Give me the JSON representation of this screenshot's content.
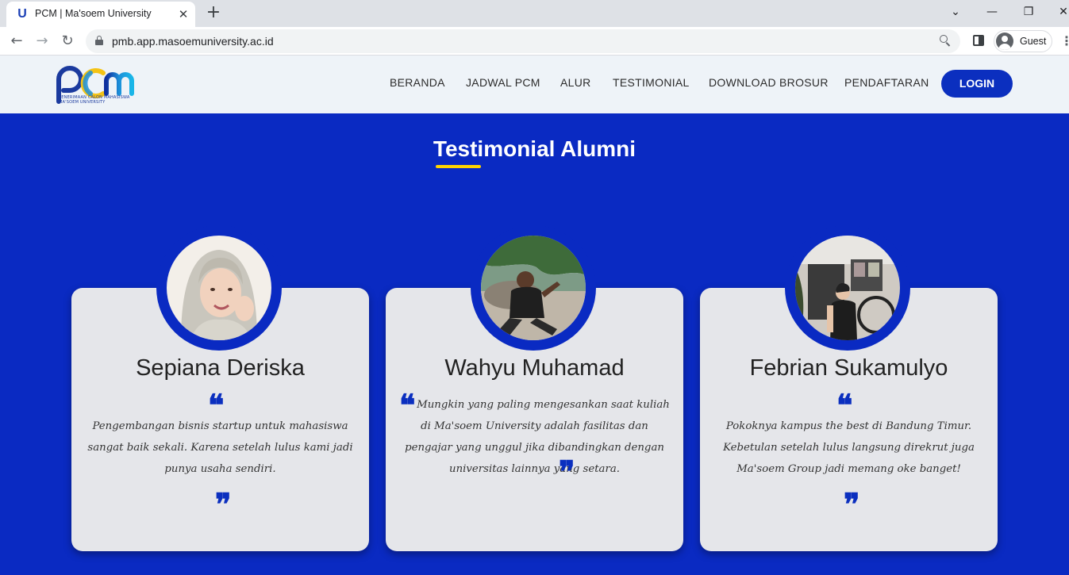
{
  "browser": {
    "tab_title": "PCM | Ma'soem University",
    "favicon": "U",
    "close": "✕",
    "new_tab": "+",
    "url": "pmb.app.masoemuniversity.ac.id",
    "profile": "Guest",
    "menu": "⋮",
    "back": "←",
    "forward": "→",
    "reload": "↻",
    "minimize": "—",
    "restore": "❐",
    "close_window": "✕",
    "tab_search": "⌄"
  },
  "header": {
    "logo_text": "pcm",
    "logo_subtitle": "PENERIMAAN CALON MAHASISWA MA'SOEM UNIVERSITY",
    "nav": [
      "BERANDA",
      "JADWAL PCM",
      "ALUR",
      "TESTIMONIAL",
      "DOWNLOAD BROSUR",
      "PENDAFTARAN"
    ],
    "login": "LOGIN"
  },
  "section": {
    "title": "Testimonial Alumni"
  },
  "testimonials": [
    {
      "name": "Sepiana Deriska",
      "text": "Pengembangan bisnis startup untuk mahasiswa sangat baik sekali. Karena setelah lulus kami jadi punya usaha sendiri."
    },
    {
      "name": "Wahyu Muhamad",
      "text": "Mungkin yang paling mengesankan saat kuliah di Ma'soem University adalah fasilitas dan pengajar yang unggul jika dibandingkan dengan universitas lainnya yang setara."
    },
    {
      "name": "Febrian Sukamulyo",
      "text": "Pokoknya kampus the best di Bandung Timur. Kebetulan setelah lulus langsung direkrut juga Ma'soem Group jadi memang oke banget!"
    }
  ],
  "quotes": {
    "open": "❝",
    "close": "❞"
  }
}
